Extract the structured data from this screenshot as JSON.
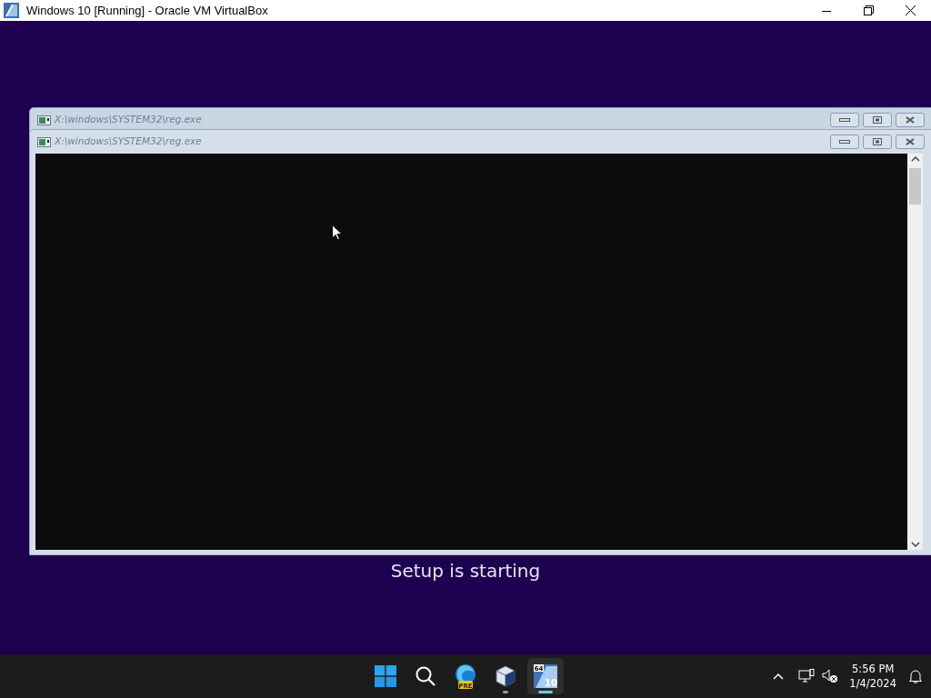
{
  "host_window": {
    "title": "Windows 10 [Running] - Oracle VM VirtualBox"
  },
  "guest": {
    "background_text": "Setup is starting",
    "console_windows": [
      {
        "title": "X:\\windows\\SYSTEM32\\reg.exe",
        "active": false
      },
      {
        "title": "X:\\windows\\SYSTEM32\\reg.exe",
        "active": true
      }
    ],
    "taskbar": {
      "items": [
        {
          "kind": "start",
          "active": false,
          "running": false
        },
        {
          "kind": "search",
          "active": false,
          "running": false
        },
        {
          "kind": "edge",
          "badge": "PRE",
          "active": false,
          "running": false
        },
        {
          "kind": "virtualbox",
          "active": false,
          "running": true
        },
        {
          "kind": "vm",
          "texts": [
            "64",
            "10"
          ],
          "active": true,
          "running": true
        }
      ],
      "time": "5:56 PM",
      "date": "1/4/2024"
    }
  }
}
